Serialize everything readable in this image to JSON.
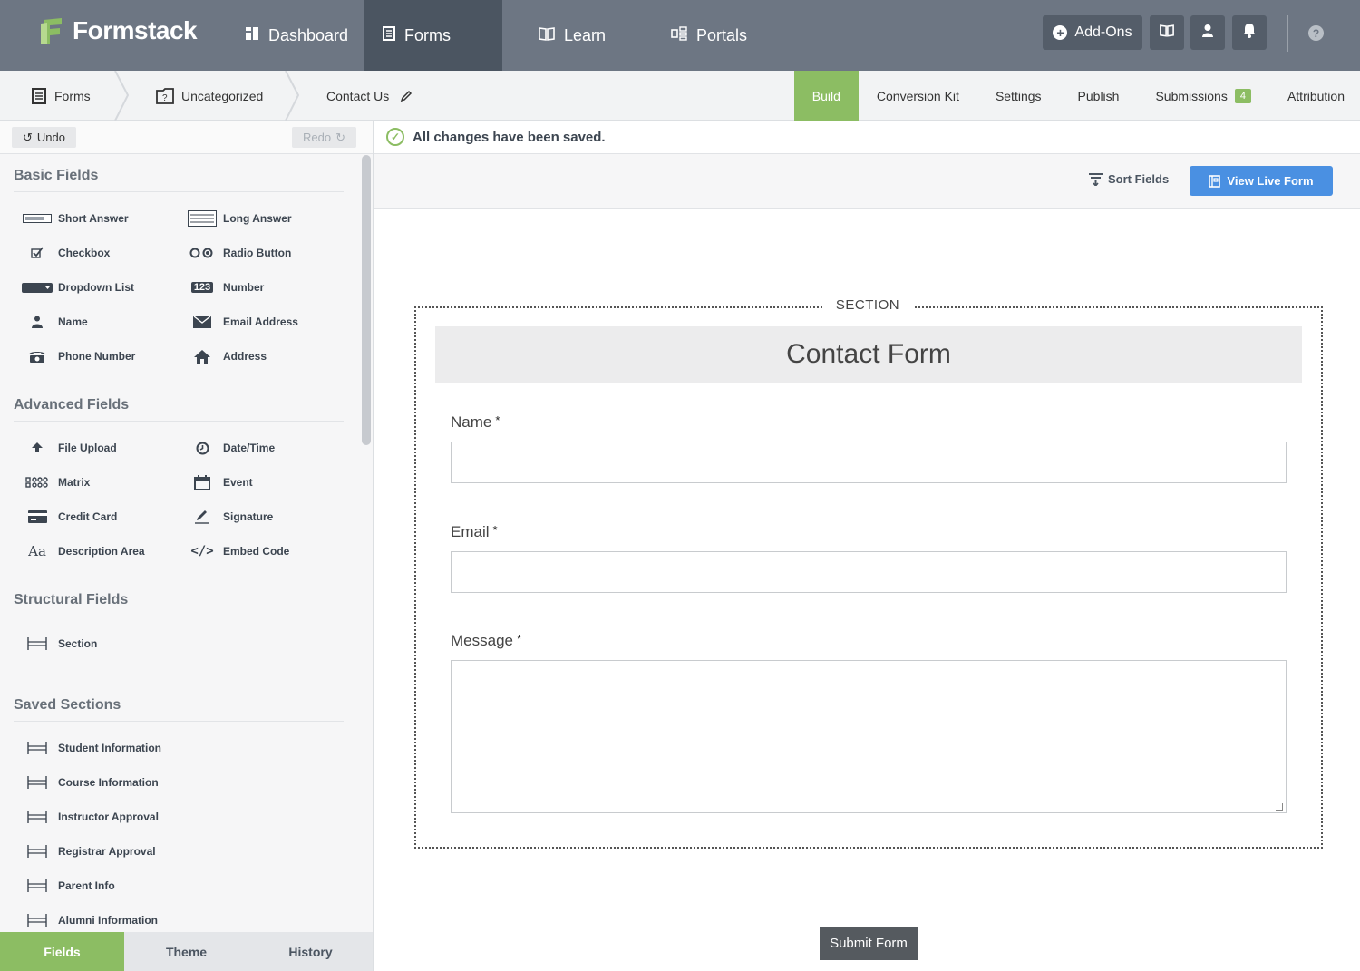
{
  "app": {
    "name": "Formstack"
  },
  "topnav": {
    "items": [
      {
        "label": "Dashboard",
        "icon": "dashboard-icon"
      },
      {
        "label": "Forms",
        "icon": "forms-icon",
        "active": true
      },
      {
        "label": "Learn",
        "icon": "book-icon"
      },
      {
        "label": "Portals",
        "icon": "portals-icon"
      }
    ],
    "addons_label": "Add-Ons"
  },
  "breadcrumb": {
    "items": [
      "Forms",
      "Uncategorized",
      "Contact Us"
    ]
  },
  "tabs": [
    {
      "label": "Build",
      "active": true
    },
    {
      "label": "Conversion Kit"
    },
    {
      "label": "Settings"
    },
    {
      "label": "Publish"
    },
    {
      "label": "Submissions",
      "badge": "4"
    },
    {
      "label": "Attribution"
    }
  ],
  "sidebar": {
    "undo_label": "Undo",
    "redo_label": "Redo",
    "groups": [
      {
        "title": "Basic Fields",
        "fields": [
          "Short Answer",
          "Long Answer",
          "Checkbox",
          "Radio Button",
          "Dropdown List",
          "Number",
          "Name",
          "Email Address",
          "Phone Number",
          "Address"
        ]
      },
      {
        "title": "Advanced Fields",
        "fields": [
          "File Upload",
          "Date/Time",
          "Matrix",
          "Event",
          "Credit Card",
          "Signature",
          "Description Area",
          "Embed Code"
        ]
      },
      {
        "title": "Structural Fields",
        "fields": [
          "Section"
        ]
      },
      {
        "title": "Saved Sections",
        "fields": [
          "Student Information",
          "Course Information",
          "Instructor Approval",
          "Registrar Approval",
          "Parent Info",
          "Alumni Information"
        ]
      }
    ],
    "bottom_tabs": [
      {
        "label": "Fields",
        "active": true
      },
      {
        "label": "Theme"
      },
      {
        "label": "History"
      }
    ]
  },
  "status": {
    "saved_text": "All changes have been saved."
  },
  "toolbar": {
    "sort_label": "Sort Fields",
    "view_live_label": "View Live Form"
  },
  "form": {
    "section_label": "SECTION",
    "header": "Contact Form",
    "fields": [
      {
        "label": "Name",
        "required_mark": "*"
      },
      {
        "label": "Email",
        "required_mark": "*"
      },
      {
        "label": "Message",
        "required_mark": "*"
      }
    ],
    "submit_label": "Submit Form"
  },
  "colors": {
    "accent_green": "#8cbd63",
    "nav_bg": "#6d7683",
    "nav_active": "#4b5561",
    "primary_blue": "#4a90e2"
  }
}
